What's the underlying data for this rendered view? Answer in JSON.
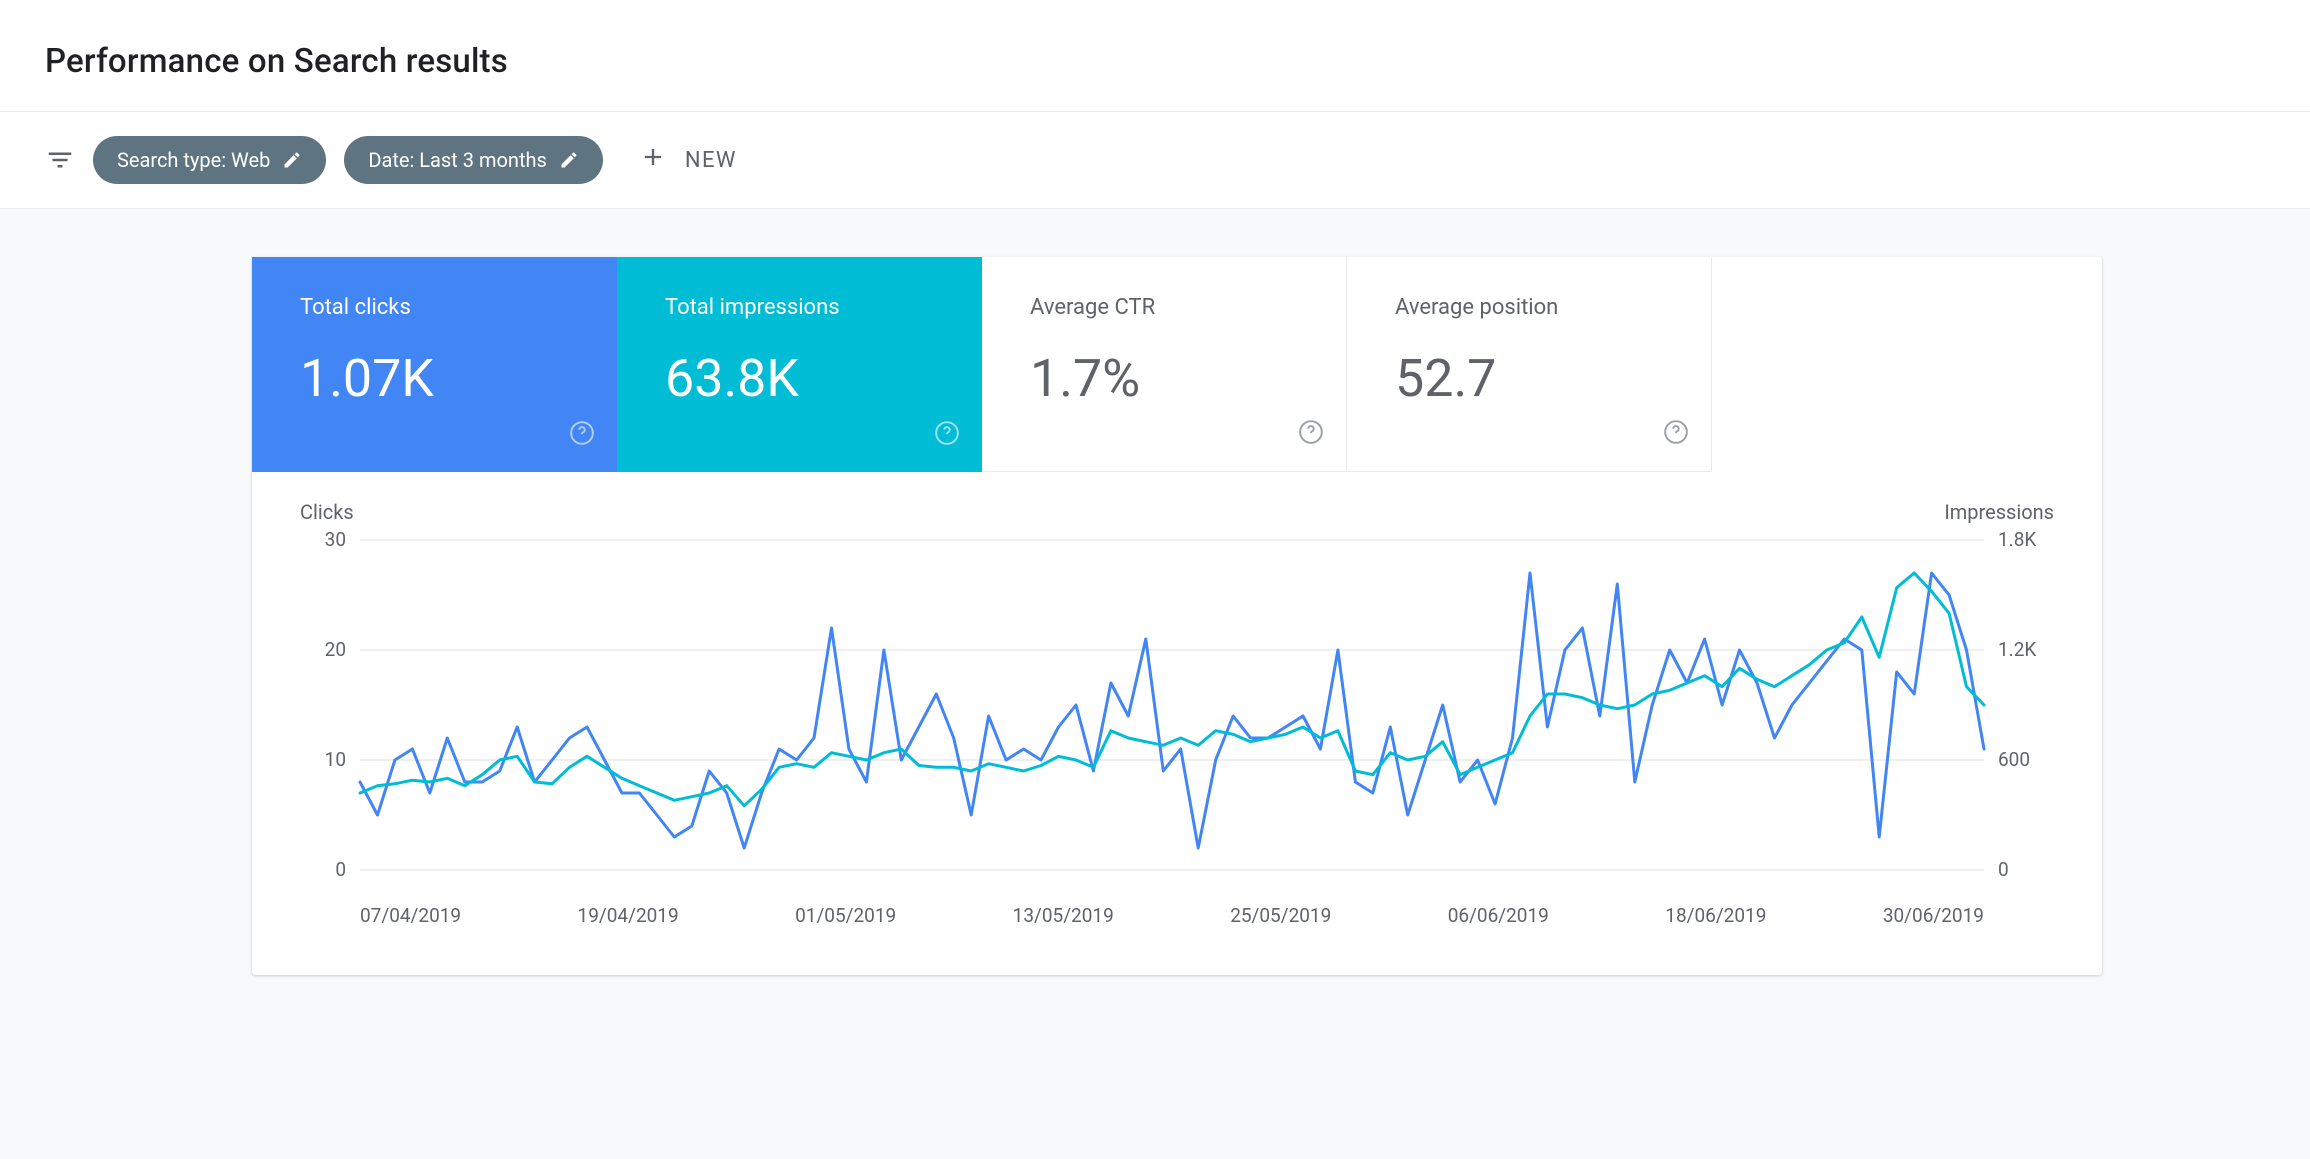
{
  "header": {
    "title": "Performance on Search results"
  },
  "filters": {
    "search_type_label": "Search type: Web",
    "date_label": "Date: Last 3 months",
    "new_label": "NEW"
  },
  "metrics": {
    "clicks": {
      "label": "Total clicks",
      "value": "1.07K"
    },
    "impressions": {
      "label": "Total impressions",
      "value": "63.8K"
    },
    "ctr": {
      "label": "Average CTR",
      "value": "1.7%"
    },
    "position": {
      "label": "Average position",
      "value": "52.7"
    }
  },
  "chart": {
    "left_axis_label": "Clicks",
    "right_axis_label": "Impressions",
    "y_left_ticks": [
      "30",
      "20",
      "10",
      "0"
    ],
    "y_right_ticks": [
      "1.8K",
      "1.2K",
      "600",
      "0"
    ],
    "x_ticks": [
      "07/04/2019",
      "19/04/2019",
      "01/05/2019",
      "13/05/2019",
      "25/05/2019",
      "06/06/2019",
      "18/06/2019",
      "30/06/2019"
    ]
  },
  "chart_data": {
    "type": "line",
    "title": "",
    "xlabel": "",
    "ylabel_left": "Clicks",
    "ylabel_right": "Impressions",
    "series": [
      {
        "name": "Clicks",
        "axis": "left",
        "ylim": [
          0,
          30
        ],
        "values": [
          8,
          5,
          10,
          11,
          7,
          12,
          8,
          8,
          9,
          13,
          8,
          10,
          12,
          13,
          10,
          7,
          7,
          5,
          3,
          4,
          9,
          7,
          2,
          7,
          11,
          10,
          12,
          22,
          11,
          8,
          20,
          10,
          13,
          16,
          12,
          5,
          14,
          10,
          11,
          10,
          13,
          15,
          9,
          17,
          14,
          21,
          9,
          11,
          2,
          10,
          14,
          12,
          12,
          13,
          14,
          11,
          20,
          8,
          7,
          13,
          5,
          10,
          15,
          8,
          10,
          6,
          12,
          27,
          13,
          20,
          22,
          14,
          26,
          8,
          15,
          20,
          17,
          21,
          15,
          20,
          17,
          12,
          15,
          17,
          19,
          21,
          20,
          3,
          18,
          16,
          27,
          25,
          20,
          11
        ]
      },
      {
        "name": "Impressions",
        "axis": "right",
        "ylim": [
          0,
          1800
        ],
        "values": [
          420,
          460,
          470,
          490,
          480,
          500,
          460,
          520,
          600,
          620,
          480,
          470,
          560,
          620,
          560,
          500,
          460,
          420,
          380,
          400,
          420,
          460,
          350,
          440,
          560,
          580,
          560,
          640,
          620,
          600,
          640,
          660,
          570,
          560,
          560,
          540,
          580,
          560,
          540,
          570,
          620,
          600,
          560,
          760,
          720,
          700,
          680,
          720,
          680,
          760,
          740,
          700,
          720,
          740,
          780,
          720,
          760,
          540,
          520,
          640,
          600,
          620,
          700,
          520,
          560,
          600,
          640,
          840,
          960,
          960,
          940,
          900,
          880,
          900,
          960,
          980,
          1020,
          1060,
          1000,
          1100,
          1040,
          1000,
          1060,
          1120,
          1200,
          1240,
          1380,
          1160,
          1540,
          1620,
          1520,
          1400,
          1000,
          900
        ]
      }
    ],
    "x_ticks": [
      "07/04/2019",
      "19/04/2019",
      "01/05/2019",
      "13/05/2019",
      "25/05/2019",
      "06/06/2019",
      "18/06/2019",
      "30/06/2019"
    ]
  }
}
